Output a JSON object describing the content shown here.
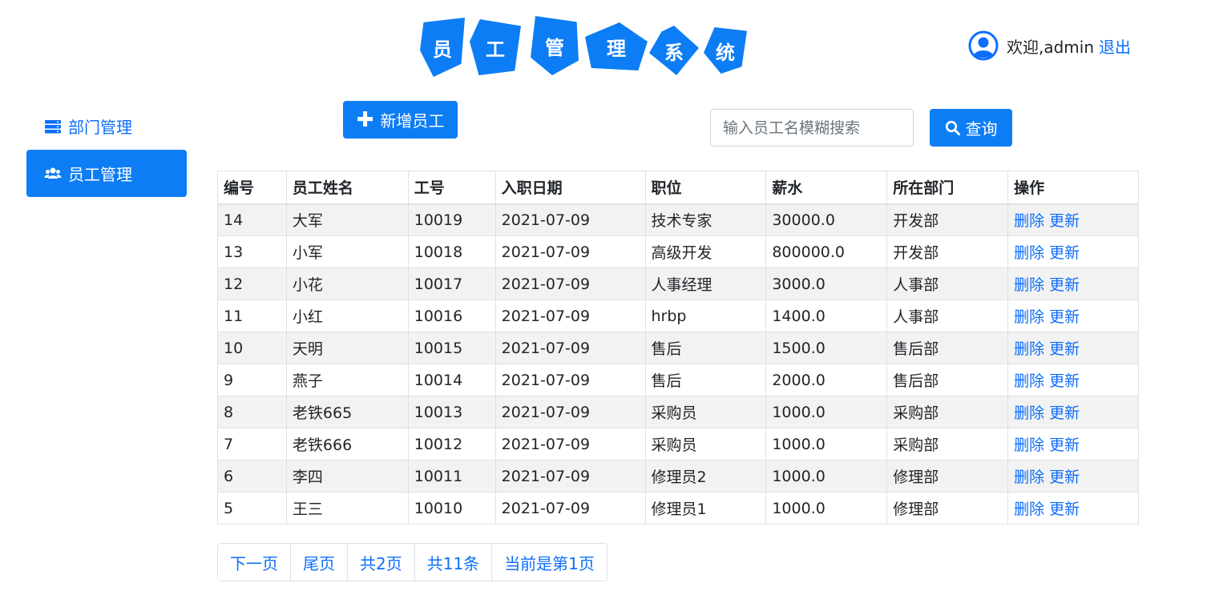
{
  "header": {
    "logo_chars": [
      "员",
      "工",
      "管",
      "理",
      "系",
      "统"
    ],
    "welcome": "欢迎,admin",
    "logout": "退出"
  },
  "sidebar": {
    "items": [
      {
        "label": "部门管理",
        "icon": "server-icon",
        "active": false
      },
      {
        "label": "员工管理",
        "icon": "users-icon",
        "active": true
      }
    ]
  },
  "toolbar": {
    "add_label": "新增员工",
    "search_placeholder": "输入员工名模糊搜索",
    "search_value": "",
    "search_label": "查询"
  },
  "table": {
    "headers": [
      "编号",
      "员工姓名",
      "工号",
      "入职日期",
      "职位",
      "薪水",
      "所在部门",
      "操作"
    ],
    "delete_label": "删除",
    "update_label": "更新",
    "rows": [
      [
        "14",
        "大军",
        "10019",
        "2021-07-09",
        "技术专家",
        "30000.0",
        "开发部"
      ],
      [
        "13",
        "小军",
        "10018",
        "2021-07-09",
        "高级开发",
        "800000.0",
        "开发部"
      ],
      [
        "12",
        "小花",
        "10017",
        "2021-07-09",
        "人事经理",
        "3000.0",
        "人事部"
      ],
      [
        "11",
        "小红",
        "10016",
        "2021-07-09",
        "hrbp",
        "1400.0",
        "人事部"
      ],
      [
        "10",
        "天明",
        "10015",
        "2021-07-09",
        "售后",
        "1500.0",
        "售后部"
      ],
      [
        "9",
        "燕子",
        "10014",
        "2021-07-09",
        "售后",
        "2000.0",
        "售后部"
      ],
      [
        "8",
        "老铁665",
        "10013",
        "2021-07-09",
        "采购员",
        "1000.0",
        "采购部"
      ],
      [
        "7",
        "老铁666",
        "10012",
        "2021-07-09",
        "采购员",
        "1000.0",
        "采购部"
      ],
      [
        "6",
        "李四",
        "10011",
        "2021-07-09",
        "修理员2",
        "1000.0",
        "修理部"
      ],
      [
        "5",
        "王三",
        "10010",
        "2021-07-09",
        "修理员1",
        "1000.0",
        "修理部"
      ]
    ]
  },
  "pagination": {
    "next": "下一页",
    "last": "尾页",
    "total_pages": "共2页",
    "total_records": "共11条",
    "current": "当前是第1页"
  },
  "colors": {
    "primary": "#0d7df5",
    "link": "#0d6efd",
    "stripe": "#f2f2f2"
  }
}
